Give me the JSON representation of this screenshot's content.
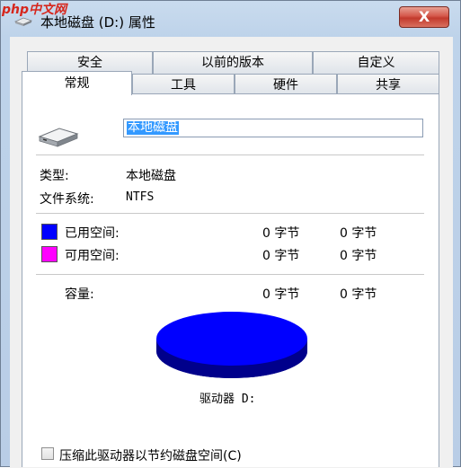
{
  "watermark": "php中文网",
  "window": {
    "title": "本地磁盘 (D:) 属性",
    "close_glyph": "X"
  },
  "tabs": {
    "row1": [
      "安全",
      "以前的版本",
      "自定义"
    ],
    "row2": [
      "常规",
      "工具",
      "硬件",
      "共享"
    ],
    "active": "常规"
  },
  "general": {
    "volume_label": "本地磁盘",
    "type_label": "类型:",
    "type_value": "本地磁盘",
    "fs_label": "文件系统:",
    "fs_value": "NTFS",
    "used_label": "已用空间:",
    "used_bytes": "0 字节",
    "used_gb": "0 字节",
    "free_label": "可用空间:",
    "free_bytes": "0 字节",
    "free_gb": "0 字节",
    "capacity_label": "容量:",
    "capacity_bytes": "0 字节",
    "capacity_gb": "0 字节",
    "drive_label": "驱动器 D:",
    "compress_label": "压缩此驱动器以节约磁盘空间(C)",
    "compress_checked": false
  },
  "colors": {
    "used": "#0000ff",
    "free": "#ff00ff"
  },
  "icons": [
    "drive-icon",
    "hard-disk-icon",
    "close-icon"
  ]
}
